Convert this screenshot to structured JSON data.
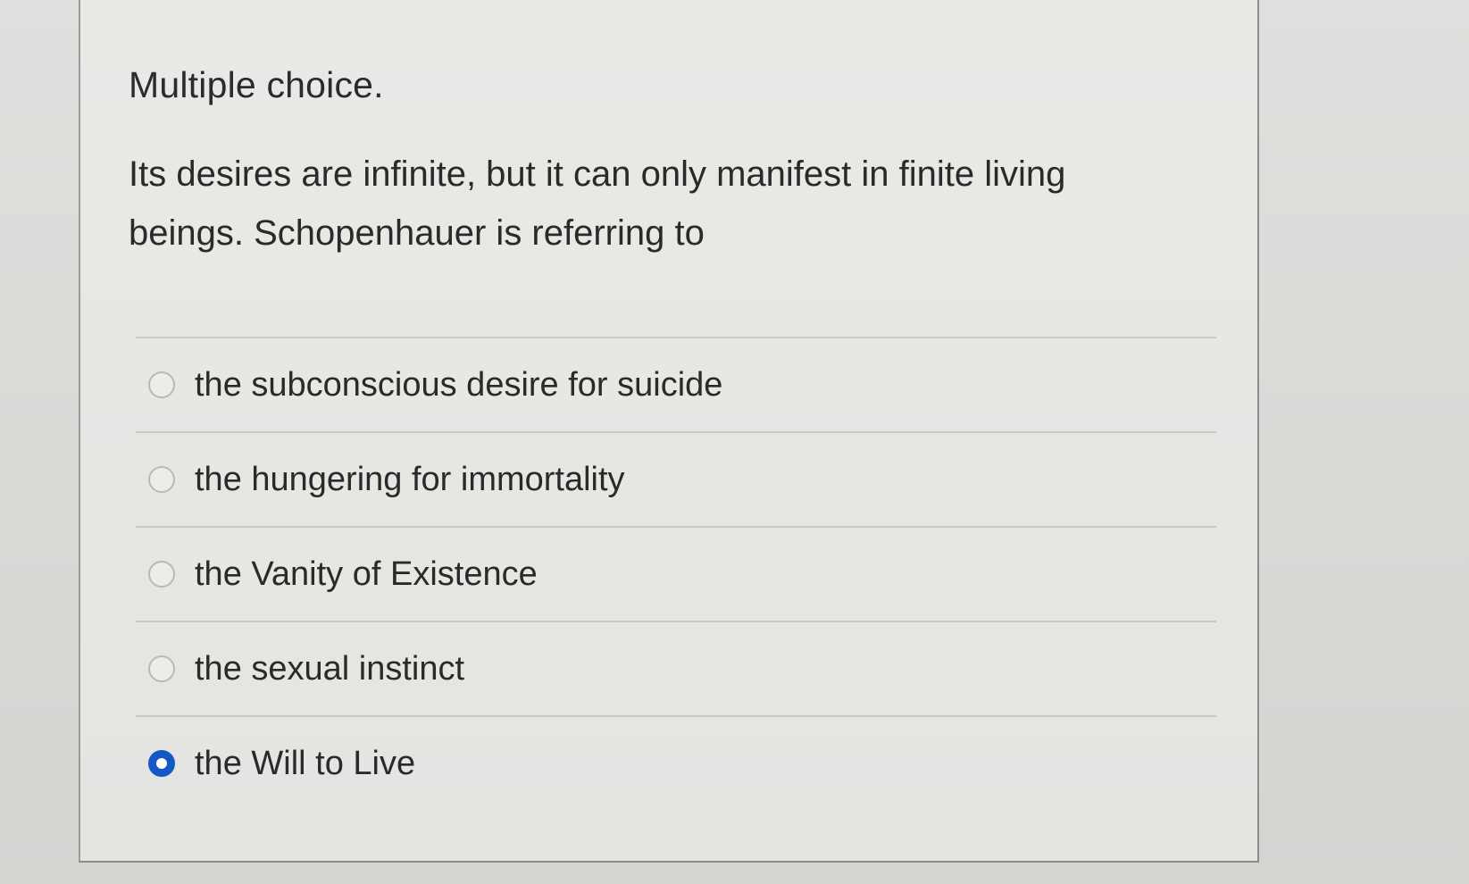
{
  "question": {
    "type_label": "Multiple choice.",
    "text": "Its desires are infinite, but it can only manifest in finite living beings. Schopenhauer is referring to"
  },
  "choices": [
    {
      "label": "the subconscious desire for suicide",
      "selected": false
    },
    {
      "label": "the hungering for immortality",
      "selected": false
    },
    {
      "label": "the Vanity of Existence",
      "selected": false
    },
    {
      "label": "the sexual instinct",
      "selected": false
    },
    {
      "label": "the Will to Live",
      "selected": true
    }
  ],
  "colors": {
    "radio_selected": "#1557c4",
    "text": "#2a2a2a"
  }
}
